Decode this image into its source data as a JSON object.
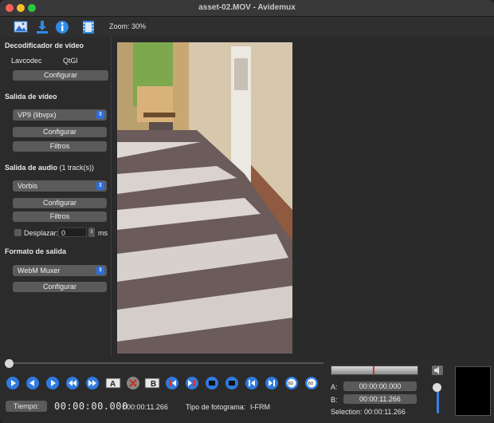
{
  "window": {
    "title": "asset-02.MOV - Avidemux"
  },
  "toolbar": {
    "zoom_label": "Zoom: 30%",
    "buttons": [
      "open-file-icon",
      "save-file-icon",
      "info-icon",
      "filmstrip-icon"
    ]
  },
  "video_decoder": {
    "heading": "Decodificador de vídeo",
    "decoder_name": "Lavcodec",
    "renderer_name": "QtGl",
    "configure_label": "Configurar"
  },
  "video_output": {
    "heading": "Salida de vídeo",
    "codec": "VP9 (libvpx)",
    "configure_label": "Configurar",
    "filters_label": "Filtros"
  },
  "audio_output": {
    "heading": "Salida de audio",
    "tracks": "(1 track(s))",
    "codec": "Vorbis",
    "configure_label": "Configurar",
    "filters_label": "Filtros",
    "shift_label": "Desplazar:",
    "shift_value": "0",
    "shift_unit": "ms"
  },
  "output_format": {
    "heading": "Formato de salida",
    "muxer": "WebM Muxer",
    "configure_label": "Configurar"
  },
  "markers": {
    "a_label": "A:",
    "a_value": "00:00:00.000",
    "b_label": "B:",
    "b_value": "00:00:11.266",
    "selection_label": "Selection:",
    "selection_value": "00:00:11.266"
  },
  "status": {
    "time_button": "Tiempo:",
    "current_time": "00:00:00.000",
    "total_time": "/ 00:00:11.266",
    "frame_type_label": "Tipo de fotograma:",
    "frame_type_value": "I-FRM"
  },
  "playback": {
    "seek_position": 0.0,
    "volume_level": 0.3
  },
  "colors": {
    "accent": "#2d6ee0",
    "background": "#2b2b2b",
    "button": "#5a5a5a"
  }
}
